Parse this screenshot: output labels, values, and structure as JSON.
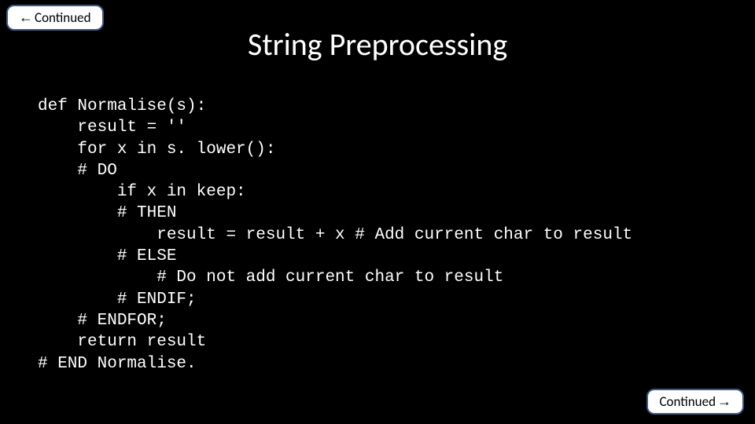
{
  "nav": {
    "prev_label": "Continued",
    "next_label": "Continued"
  },
  "title": "String Preprocessing",
  "code": {
    "lines": [
      "def Normalise(s):",
      "    result = ''",
      "    for x in s. lower():",
      "    # DO",
      "        if x in keep:",
      "        # THEN",
      "            result = result + x # Add current char to result",
      "        # ELSE",
      "            # Do not add current char to result",
      "        # ENDIF;",
      "    # ENDFOR;",
      "    return result",
      "# END Normalise."
    ]
  }
}
